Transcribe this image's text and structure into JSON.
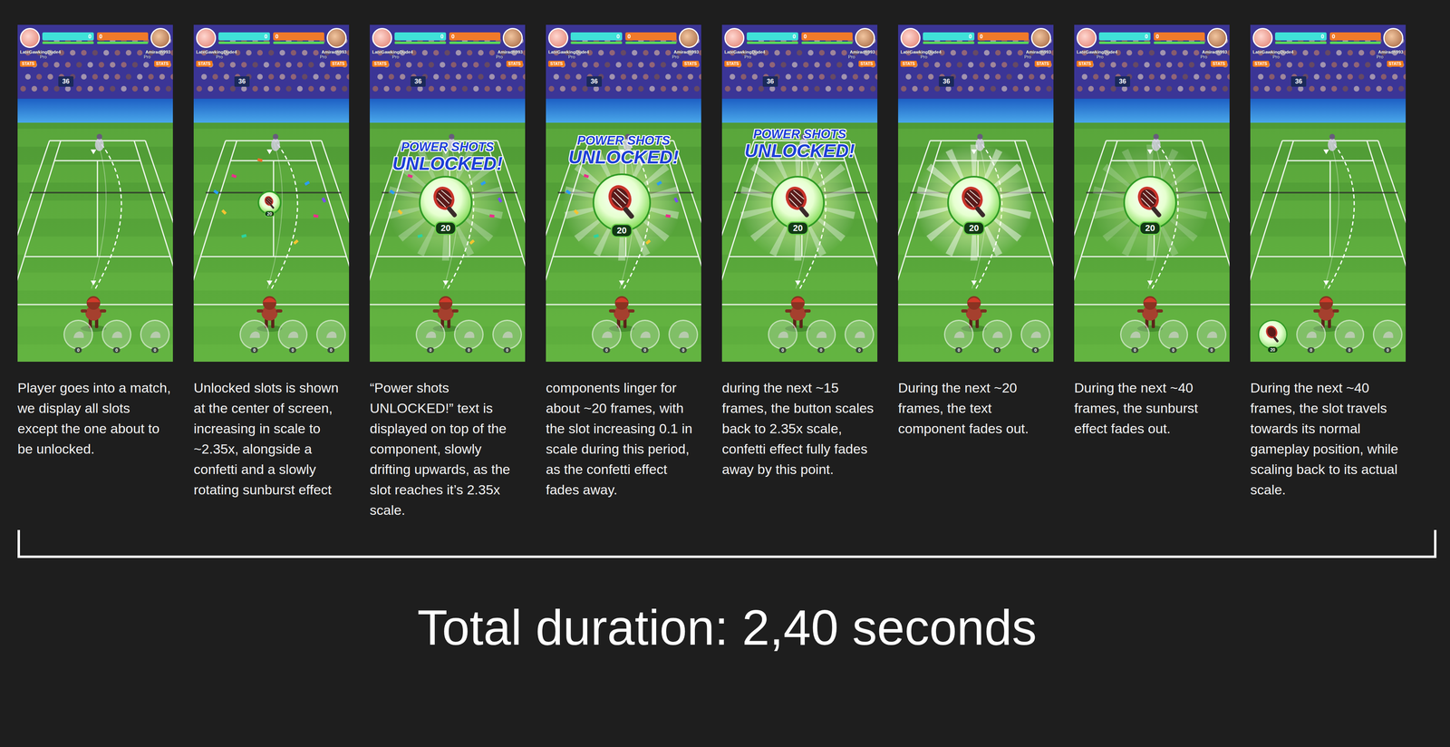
{
  "hud": {
    "players": [
      {
        "name": "LateGawkingDude4",
        "rank": "Pro",
        "score": "0",
        "stats": "STATS"
      },
      {
        "name": "Amiradh993",
        "rank": "Pro",
        "score": "0",
        "stats": "STATS"
      }
    ],
    "scoreboard": "36"
  },
  "unlock": {
    "headline": "POWER SHOTS",
    "subline": "UNLOCKED!",
    "count": "20"
  },
  "bar_slots": [
    {
      "count": "0"
    },
    {
      "count": "0"
    },
    {
      "count": "0"
    }
  ],
  "frames": [
    {
      "caption": "Player goes into a match, we display all slots except the one about to be unlocked.",
      "phase": "hidden",
      "headline": false,
      "confetti": false,
      "sunburst_level": 0,
      "docked": false
    },
    {
      "caption": "Unlocked slots is shown at the center of screen, increasing in scale to ~2.35x, alongside a confetti and a slowly rotating sunburst effect",
      "phase": "growing",
      "headline": false,
      "confetti": true,
      "sunburst_level": 0,
      "docked": false
    },
    {
      "caption": "“Power shots UNLOCKED!” text is displayed on top of the component, slowly drifting upwards, as the slot reaches it’s 2.35x scale.",
      "phase": "full",
      "headline": true,
      "confetti": true,
      "sunburst_level": 0.6,
      "docked": false
    },
    {
      "caption": "components linger for about ~20 frames, with the slot increasing 0.1 in scale during this period, as the confetti effect fades away.",
      "phase": "peak",
      "headline": true,
      "confetti": true,
      "sunburst_level": 0.8,
      "docked": false
    },
    {
      "caption": "during the next ~15 frames, the button scales back to 2.35x scale, confetti effect fully fades away by this point.",
      "phase": "full",
      "headline": true,
      "confetti": false,
      "sunburst_level": 0.8,
      "docked": false
    },
    {
      "caption": "During the next ~20 frames, the text component fades out.",
      "phase": "full",
      "headline": false,
      "confetti": false,
      "sunburst_level": 1,
      "docked": false
    },
    {
      "caption": "During the next ~40 frames, the sunburst effect fades out.",
      "phase": "full",
      "headline": false,
      "confetti": false,
      "sunburst_level": 0.45,
      "docked": false
    },
    {
      "caption": "During the next ~40 frames, the slot travels towards its normal gameplay position, while scaling back to its actual scale.",
      "phase": "docked",
      "headline": false,
      "confetti": false,
      "sunburst_level": 0,
      "docked": true
    }
  ],
  "total": "Total duration: 2,40 seconds"
}
